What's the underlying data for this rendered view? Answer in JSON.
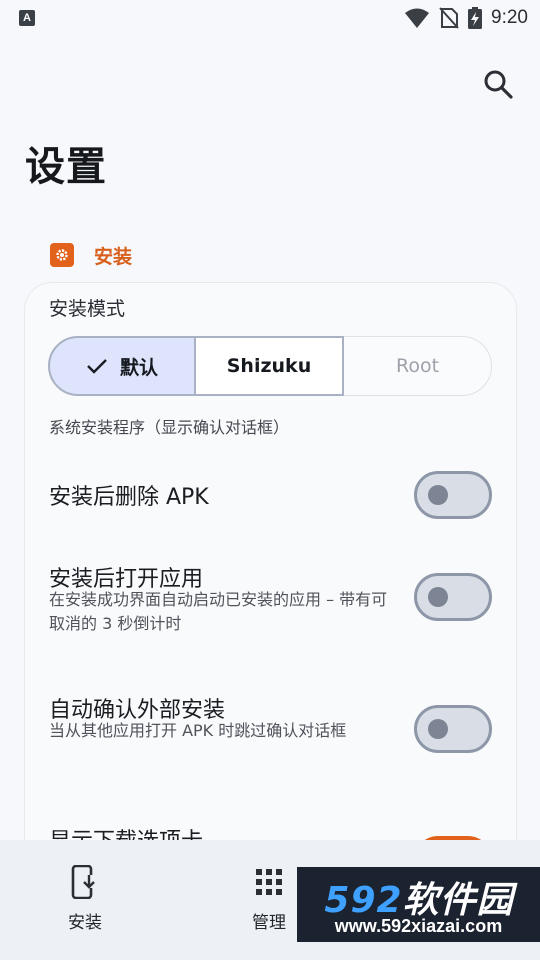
{
  "status_bar": {
    "time": "9:20",
    "app_icon_letter": "A",
    "icons": [
      "notification-app-icon",
      "wifi-icon",
      "no-sim-icon",
      "battery-charging-icon"
    ]
  },
  "header": {
    "title": "设置",
    "search_icon": "search-icon"
  },
  "section": {
    "title": "安装",
    "icon": "gear-icon",
    "accent_color": "#e2621b"
  },
  "install_mode": {
    "label": "安装模式",
    "options": [
      "默认",
      "Shizuku",
      "Root"
    ],
    "selected": "默认",
    "description": "系统安装程序（显示确认对话框）"
  },
  "settings": [
    {
      "title": "安装后删除 APK",
      "subtitle": "",
      "enabled": false
    },
    {
      "title": "安装后打开应用",
      "subtitle": "在安装成功界面自动启动已安装的应用 – 带有可取消的 3 秒倒计时",
      "enabled": false
    },
    {
      "title": "自动确认外部安装",
      "subtitle": "当从其他应用打开 APK 时跳过确认对话框",
      "enabled": false
    },
    {
      "title": "显示下载选项卡",
      "subtitle": "",
      "enabled": true
    }
  ],
  "bottom_nav": {
    "items": [
      {
        "label": "安装",
        "icon": "phone-download-icon"
      },
      {
        "label": "管理",
        "icon": "grid-icon"
      }
    ]
  },
  "watermark": {
    "number": "592",
    "name": "软件园",
    "url": "www.592xiazai.com"
  },
  "colors": {
    "accent": "#e2621b",
    "selected_segment": "#dde4fb",
    "background": "#f7f8fb"
  }
}
